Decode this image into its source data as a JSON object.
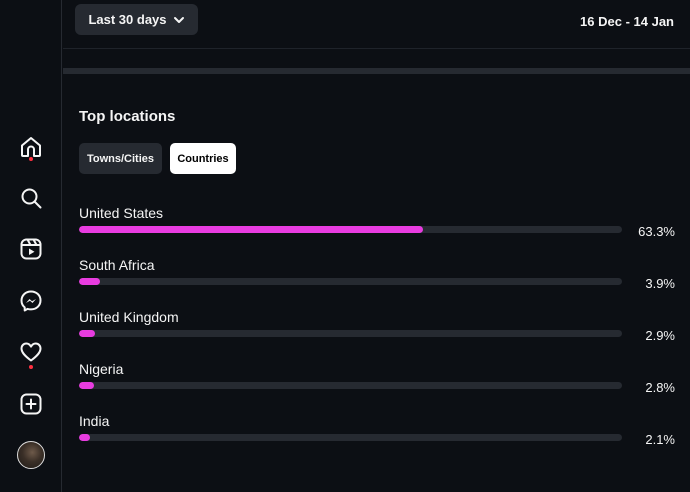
{
  "header": {
    "range_label": "Last 30 days",
    "date_range": "16 Dec - 14 Jan"
  },
  "sidebar": {
    "items": [
      {
        "name": "home",
        "icon": "home-icon",
        "notification_dot": true
      },
      {
        "name": "search",
        "icon": "search-icon",
        "notification_dot": false
      },
      {
        "name": "reels",
        "icon": "reels-icon",
        "notification_dot": false
      },
      {
        "name": "messenger",
        "icon": "messenger-icon",
        "notification_dot": false
      },
      {
        "name": "notifications",
        "icon": "heart-icon",
        "notification_dot": true
      },
      {
        "name": "create",
        "icon": "plus-square-icon",
        "notification_dot": false
      },
      {
        "name": "profile",
        "icon": "avatar",
        "notification_dot": false
      }
    ],
    "dot_color": "#ff3040"
  },
  "top_locations": {
    "title": "Top locations",
    "tabs": [
      {
        "label": "Towns/Cities",
        "selected": false
      },
      {
        "label": "Countries",
        "selected": true
      }
    ],
    "accent_color": "#e83ce0",
    "rows": [
      {
        "name": "United States",
        "percent_label": "63.3%",
        "percent": 63.3
      },
      {
        "name": "South Africa",
        "percent_label": "3.9%",
        "percent": 3.9
      },
      {
        "name": "United Kingdom",
        "percent_label": "2.9%",
        "percent": 2.9
      },
      {
        "name": "Nigeria",
        "percent_label": "2.8%",
        "percent": 2.8
      },
      {
        "name": "India",
        "percent_label": "2.1%",
        "percent": 2.1
      }
    ]
  }
}
